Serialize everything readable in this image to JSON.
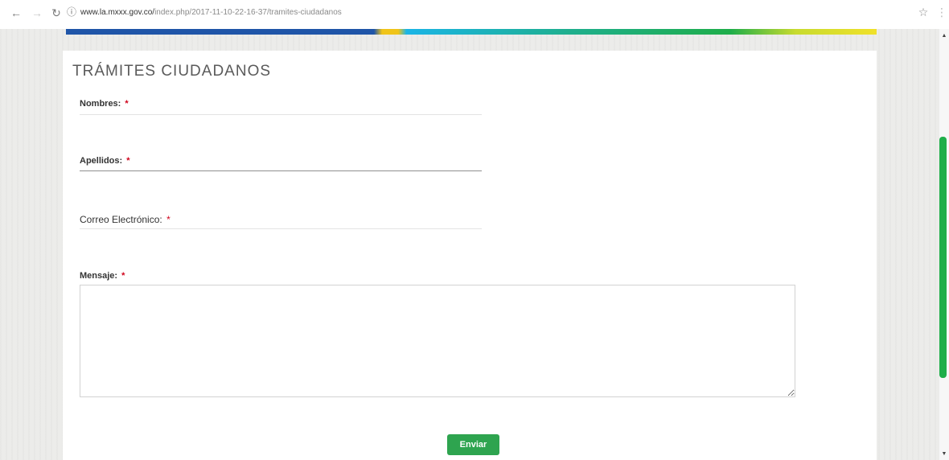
{
  "browser": {
    "back_icon": "arrow-left-icon",
    "url_host": "www.la.mxxx.gov.co/",
    "url_path": "index.php/2017-11-10-22-16-37/tramites-ciudadanos",
    "icons": [
      "arrow-left-icon",
      "arrow-right-icon",
      "reload-icon",
      "info-icon",
      "star-icon",
      "menu-dots-icon"
    ]
  },
  "page": {
    "title": "TRÁMITES CIUDADANOS",
    "required_mark": "*",
    "fields": [
      {
        "label": "Nombres:",
        "value": ""
      },
      {
        "label": "Apellidos:",
        "value": ""
      },
      {
        "label": "Correo Electrónico:",
        "value": ""
      }
    ],
    "message": {
      "label": "Mensaje:",
      "value": ""
    },
    "submit_label": "Enviar"
  },
  "colors": {
    "accent": "#2ea44f",
    "stripe_blue": "#1f55a8",
    "stripe_cyan": "#1bb5e6",
    "stripe_green": "#1fae4a",
    "stripe_yellow": "#f0e12a",
    "required": "#d0021b"
  }
}
